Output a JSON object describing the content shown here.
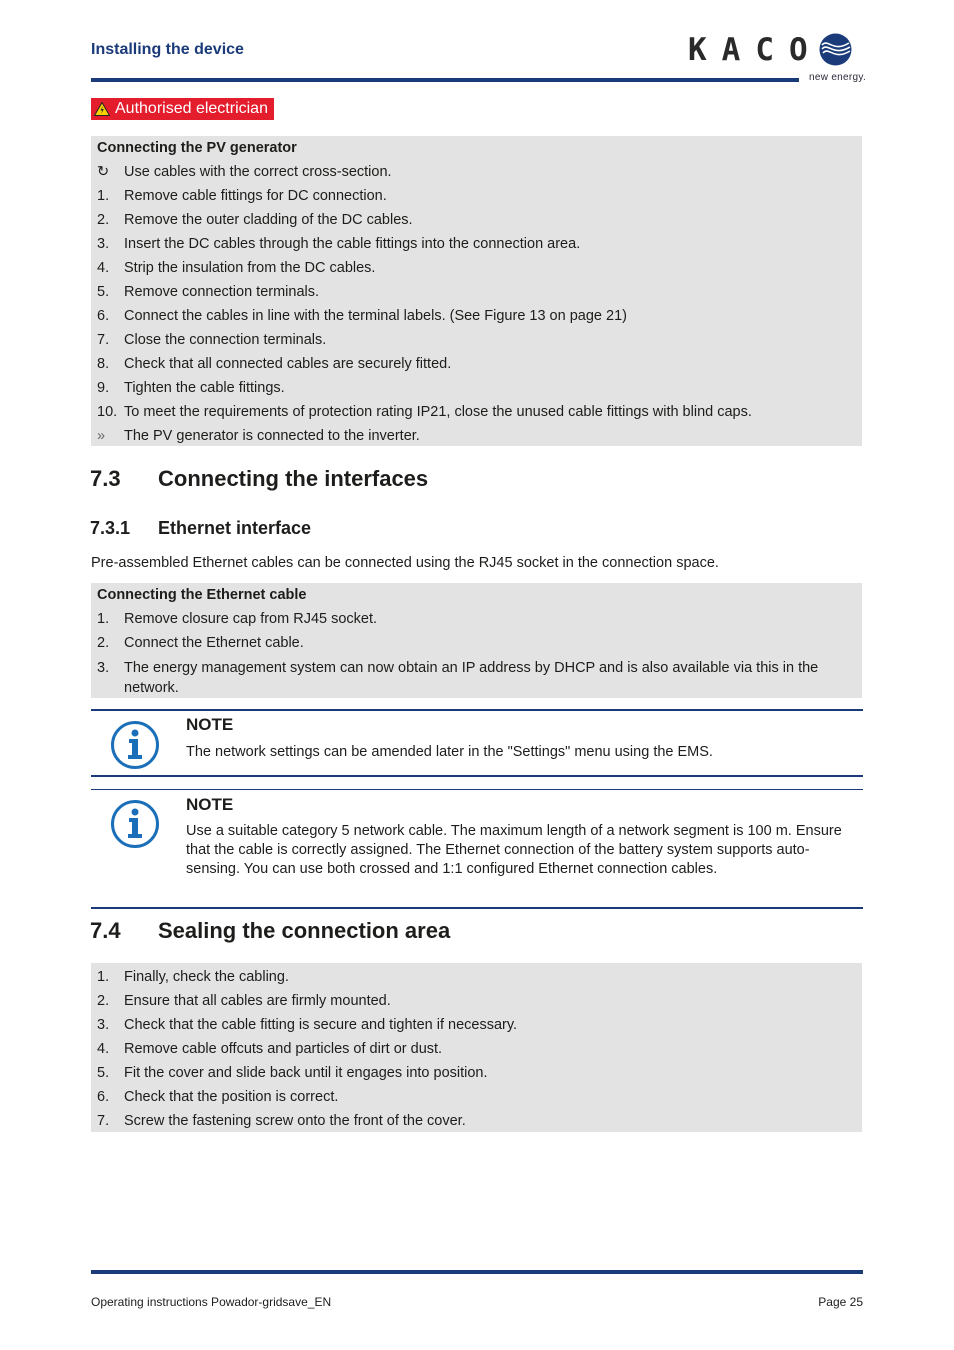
{
  "header": {
    "section_title": "Installing the device",
    "logo_text": "KACO",
    "logo_tagline": "new energy."
  },
  "warning_badge": {
    "label": "Authorised electrician",
    "icon": "warning-triangle-icon",
    "color": "#e41d2d"
  },
  "pv_box": {
    "title": "Connecting the PV generator",
    "prerequisite": {
      "marker": "↻",
      "text": "Use cables with the correct cross-section."
    },
    "steps": [
      {
        "n": "1.",
        "text": "Remove cable fittings for DC connection."
      },
      {
        "n": "2.",
        "text": "Remove the outer cladding of the DC cables."
      },
      {
        "n": "3.",
        "text": "Insert the DC cables through the cable fittings into the connection area."
      },
      {
        "n": "4.",
        "text": "Strip the insulation from the DC cables."
      },
      {
        "n": "5.",
        "text": "Remove connection terminals."
      },
      {
        "n": "6.",
        "text": "Connect the cables in line with the terminal labels. (See Figure 13 on page 21)"
      },
      {
        "n": "7.",
        "text": "Close the connection terminals."
      },
      {
        "n": "8.",
        "text": "Check that all connected cables are securely fitted."
      },
      {
        "n": "9.",
        "text": "Tighten the cable fittings."
      },
      {
        "n": "10.",
        "text": "To meet the requirements of protection rating IP21, close the unused cable fittings with blind caps."
      }
    ],
    "result": {
      "marker": "»",
      "text": "The PV generator is connected to the inverter."
    }
  },
  "section_7_3": {
    "number": "7.3",
    "title": "Connecting the interfaces"
  },
  "section_7_3_1": {
    "number": "7.3.1",
    "title": "Ethernet interface",
    "intro": "Pre-assembled Ethernet cables can be connected using the RJ45 socket in the connection space."
  },
  "ethernet_box": {
    "title": "Connecting the Ethernet cable",
    "steps": [
      {
        "n": "1.",
        "text": "Remove closure cap from RJ45 socket."
      },
      {
        "n": "2.",
        "text": "Connect the Ethernet cable."
      },
      {
        "n": "3.",
        "text": "The energy management system can now obtain an IP address by DHCP and is also available via this in the network."
      }
    ]
  },
  "notes": [
    {
      "heading": "NOTE",
      "text": "The network settings can be amended later in the \"Settings\" menu using the EMS."
    },
    {
      "heading": "NOTE",
      "text": "Use a suitable category 5 network cable. The maximum length of a network segment is 100 m. Ensure that the cable is correctly assigned. The Ethernet connection of the battery system supports auto-sensing. You can use both crossed and 1:1 configured Ethernet connection cables."
    }
  ],
  "section_7_4": {
    "number": "7.4",
    "title": "Sealing the connection area",
    "steps": [
      {
        "n": "1.",
        "text": "Finally, check the cabling."
      },
      {
        "n": "2.",
        "text": "Ensure that all cables are firmly mounted."
      },
      {
        "n": "3.",
        "text": "Check that the cable fitting is secure and tighten if necessary."
      },
      {
        "n": "4.",
        "text": "Remove cable offcuts and particles of dirt or dust."
      },
      {
        "n": "5.",
        "text": "Fit the cover and slide back until it engages into position."
      },
      {
        "n": "6.",
        "text": "Check that the position is correct."
      },
      {
        "n": "7.",
        "text": "Screw the fastening screw onto the front of the cover."
      }
    ]
  },
  "footer": {
    "document": "Operating instructions Powador-gridsave_EN",
    "page": "Page 25"
  },
  "colors": {
    "brand_blue": "#1a3a7a",
    "warning_red": "#e41d2d",
    "box_grey": "#e3e3e3"
  }
}
